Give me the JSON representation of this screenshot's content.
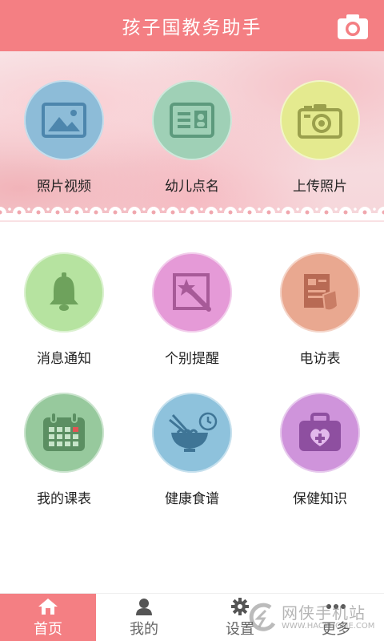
{
  "header": {
    "title": "孩子国教务助手",
    "bg_color": "#f47f83",
    "camera_icon": "camera-icon"
  },
  "banner_items": [
    {
      "label": "照片视频",
      "icon": "photo-icon",
      "color": "#8dbcd8"
    },
    {
      "label": "幼儿点名",
      "icon": "id-card-icon",
      "color": "#9fd0b6"
    },
    {
      "label": "上传照片",
      "icon": "camera-icon",
      "color": "#e4ea8f"
    }
  ],
  "grid_items": [
    {
      "label": "消息通知",
      "icon": "bell-icon",
      "color": "#b6e3a0"
    },
    {
      "label": "个别提醒",
      "icon": "magic-wand-icon",
      "color": "#e59ad7"
    },
    {
      "label": "电访表",
      "icon": "form-icon",
      "color": "#e9a890"
    },
    {
      "label": "我的课表",
      "icon": "calendar-icon",
      "color": "#97c99d"
    },
    {
      "label": "健康食谱",
      "icon": "bowl-icon",
      "color": "#8ec2dc"
    },
    {
      "label": "保健知识",
      "icon": "medical-kit-icon",
      "color": "#cf94db"
    }
  ],
  "tabbar": {
    "accent": "#f47f83",
    "tabs": [
      {
        "label": "首页",
        "icon": "home-icon",
        "active": true
      },
      {
        "label": "我的",
        "icon": "user-icon",
        "active": false
      },
      {
        "label": "设置",
        "icon": "gear-icon",
        "active": false
      },
      {
        "label": "更多",
        "icon": "more-icon",
        "active": false
      }
    ]
  },
  "watermark": {
    "text": "网侠手机站",
    "url": "WWW.HACKHOME.COM"
  }
}
